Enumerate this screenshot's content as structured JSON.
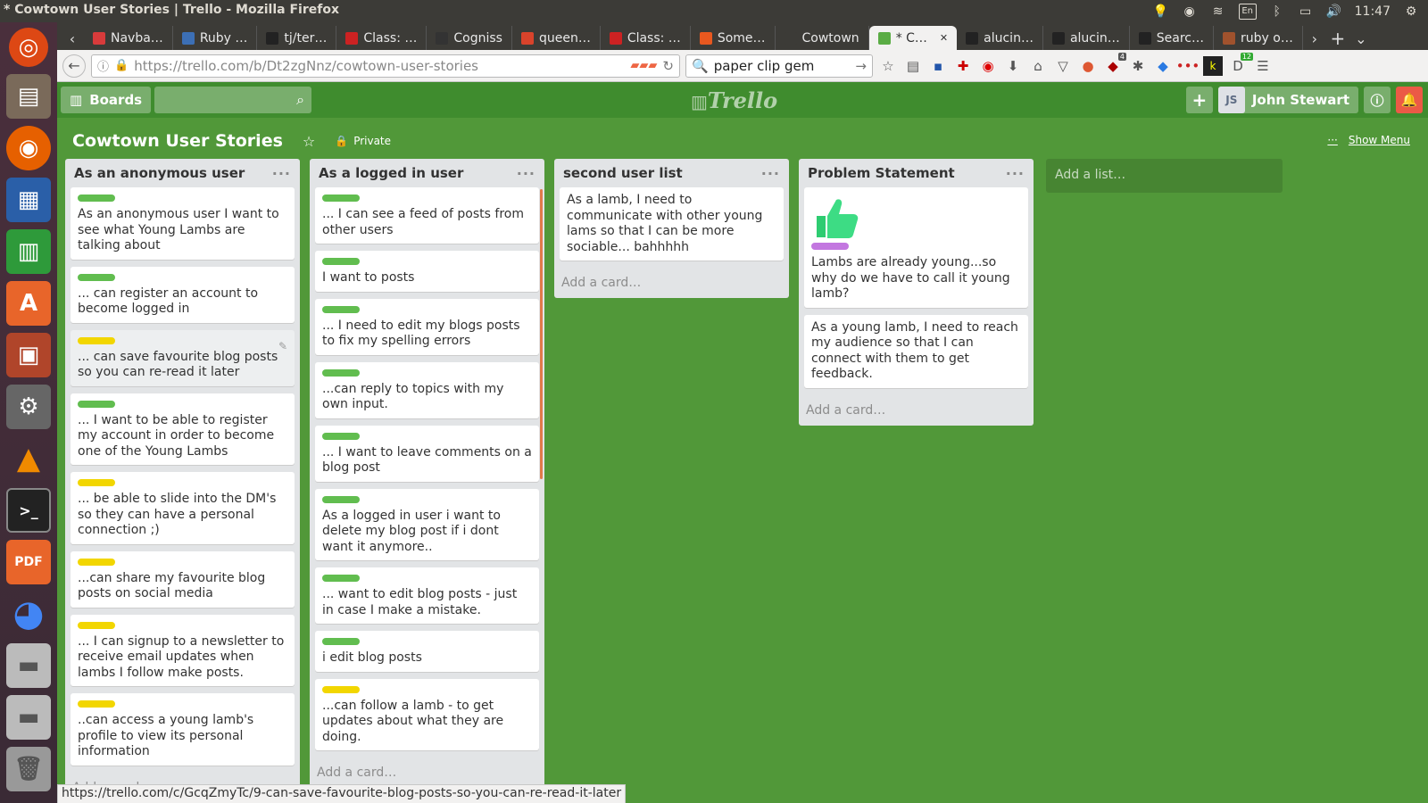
{
  "window": {
    "title": "* Cowtown User Stories | Trello - Mozilla Firefox",
    "tray": {
      "lang": "En",
      "time": "11:47"
    }
  },
  "tabs": [
    {
      "label": "Navba…",
      "color": "#d83b3b"
    },
    {
      "label": "Ruby …",
      "color": "#3c6fb5"
    },
    {
      "label": "tj/ter…",
      "color": "#222222"
    },
    {
      "label": "Class: …",
      "color": "#cc2222"
    },
    {
      "label": "Cogniss",
      "color": "#333333"
    },
    {
      "label": "queen…",
      "color": "#d9432b"
    },
    {
      "label": "Class: …",
      "color": "#cc2222"
    },
    {
      "label": "Some…",
      "color": "#e8581f"
    },
    {
      "label": "Cowtown",
      "color": "#3c3b37"
    },
    {
      "label": "* C…",
      "color": "#5aac44",
      "active": true
    },
    {
      "label": "alucin…",
      "color": "#222222"
    },
    {
      "label": "alucin…",
      "color": "#222222"
    },
    {
      "label": "Searc…",
      "color": "#222222"
    },
    {
      "label": "ruby o…",
      "color": "#a0522d"
    }
  ],
  "nav": {
    "url_host": "https://trello.com",
    "url_path": "/b/Dt2zgNnz/cowtown-user-stories",
    "search_value": "paper clip gem",
    "badge_addon": "4",
    "badge_ext": "12"
  },
  "trello": {
    "boards_label": "Boards",
    "logo": "Trello",
    "user_initials": "JS",
    "user_name": "John Stewart",
    "board_title": "Cowtown User Stories",
    "visibility": "Private",
    "show_menu": "Show Menu",
    "add_list": "Add a list…",
    "add_card": "Add a card…"
  },
  "lists": [
    {
      "title": "As an anonymous user",
      "cards": [
        {
          "label": "#61bd4f",
          "text": "As an anonymous user I want to see what Young Lambs are talking about"
        },
        {
          "label": "#61bd4f",
          "text": "... can register an account to become logged in"
        },
        {
          "label": "#f2d600",
          "text": "... can save favourite blog posts so you can re-read it later",
          "hover": true
        },
        {
          "label": "#61bd4f",
          "text": "... I want to be able to register my account in order to become one of the Young Lambs"
        },
        {
          "label": "#f2d600",
          "text": "... be able to slide into the DM's so they can have a personal connection ;)"
        },
        {
          "label": "#f2d600",
          "text": "...can share my favourite blog posts on social media"
        },
        {
          "label": "#f2d600",
          "text": "... I can signup to a newsletter to receive email updates when lambs I follow make posts."
        },
        {
          "label": "#f2d600",
          "text": "..can access a young lamb's profile to view its personal information"
        }
      ]
    },
    {
      "title": "As a logged in user",
      "cards": [
        {
          "label": "#61bd4f",
          "text": "... I can see a feed of posts from other users"
        },
        {
          "label": "#61bd4f",
          "text": "I want to posts"
        },
        {
          "label": "#61bd4f",
          "text": "... I need to edit my blogs posts to fix my spelling errors"
        },
        {
          "label": "#61bd4f",
          "text": "...can reply to topics with my own input."
        },
        {
          "label": "#61bd4f",
          "text": "... I want to leave comments on a blog post"
        },
        {
          "label": "#61bd4f",
          "text": "As a logged in user i want to delete my blog post if i dont want it anymore.."
        },
        {
          "label": "#61bd4f",
          "text": "... want to edit blog posts - just in case I make a mistake."
        },
        {
          "label": "#61bd4f",
          "text": "i edit blog posts"
        },
        {
          "label": "#f2d600",
          "text": "...can follow a lamb - to get updates about what they are doing."
        }
      ]
    },
    {
      "title": "second user list",
      "cards": [
        {
          "text": "As a lamb, I need to communicate with other young lams so that I can be more sociable... bahhhhh"
        }
      ]
    },
    {
      "title": "Problem Statement",
      "cards": [
        {
          "image": true,
          "label": "#c377e0",
          "text": "Lambs are already young...so why do we have to call it young lamb?"
        },
        {
          "text": "As a young lamb, I need to reach my audience so that I can connect with them to get feedback."
        }
      ]
    }
  ],
  "status_url": "https://trello.com/c/GcqZmyTc/9-can-save-favourite-blog-posts-so-you-can-re-read-it-later"
}
